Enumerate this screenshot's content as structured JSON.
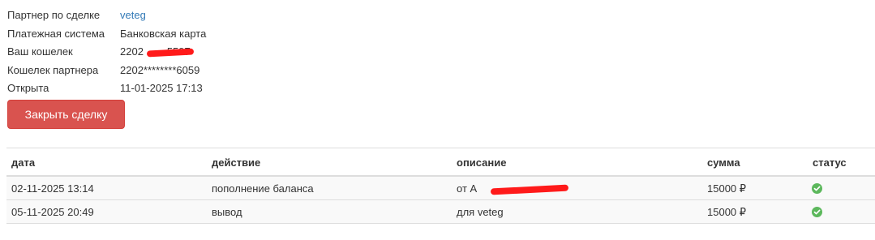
{
  "deal": {
    "partner_label": "Партнер по сделке",
    "partner_value": "veteg",
    "payment_label": "Платежная система",
    "payment_value": "Банковская карта",
    "wallet_label": "Ваш кошелек",
    "wallet_value": "2202        5597",
    "partner_wallet_label": "Кошелек партнера",
    "partner_wallet_value": "2202********6059",
    "opened_label": "Открыта",
    "opened_value": "11-01-2025 17:13"
  },
  "close_button_label": "Закрыть сделку",
  "table": {
    "headers": {
      "date": "дата",
      "action": "действие",
      "description": "описание",
      "amount": "сумма",
      "status": "статус"
    },
    "rows": [
      {
        "date": "02-11-2025 13:14",
        "action": "пополнение баланса",
        "description": "от А",
        "amount": "15000 ₽",
        "status_icon": "check-circle-icon"
      },
      {
        "date": "05-11-2025 20:49",
        "action": "вывод",
        "description": "для veteg",
        "amount": "15000 ₽",
        "status_icon": "check-circle-icon"
      }
    ]
  },
  "colors": {
    "danger": "#d9534f",
    "link": "#337ab7",
    "success": "#5cb85c",
    "redaction": "#ff1a1a"
  }
}
